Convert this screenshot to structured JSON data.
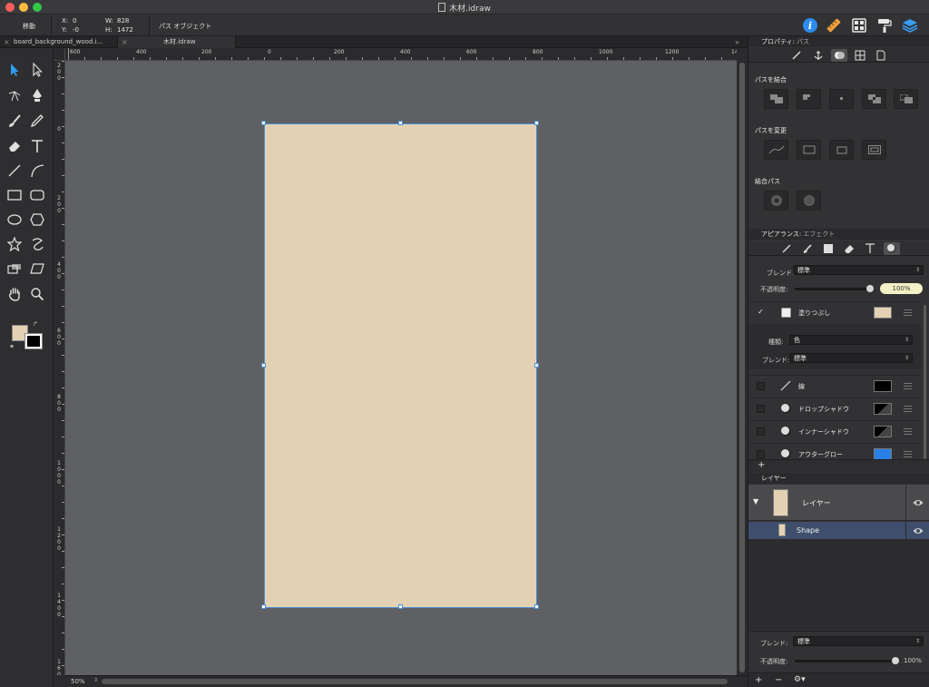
{
  "window": {
    "title": "木材.idraw"
  },
  "toolbar": {
    "mode_label": "移動",
    "x_label": "X:",
    "x_value": "0",
    "y_label": "Y:",
    "y_value": "-0",
    "w_label": "W:",
    "w_value": "828",
    "h_label": "H:",
    "h_value": "1472",
    "object_type": "パス オブジェクト",
    "icons": [
      "info-icon",
      "ruler-icon",
      "components-icon",
      "paint-roller-icon",
      "layers-icon"
    ]
  },
  "tabs": [
    {
      "label": "board_background_wood.i...",
      "active": false
    },
    {
      "label": "木材.idraw",
      "active": true
    }
  ],
  "tab_overflow": "»",
  "ruler": {
    "horizontal_labels": [
      "600",
      "400",
      "200",
      "0",
      "200",
      "400",
      "600",
      "800",
      "1000",
      "1200",
      "1400"
    ],
    "vertical_labels": [
      "200",
      "0",
      "200",
      "400",
      "600",
      "800",
      "1000",
      "1200",
      "1400",
      "1600"
    ]
  },
  "status": {
    "zoom": "50%",
    "zoom_arrows": "⇕"
  },
  "properties": {
    "header": "プロパティ:",
    "header_sub": "パス",
    "tabs": [
      "pen-icon",
      "anchor-icon",
      "boolean-icon",
      "grid-icon",
      "document-icon"
    ],
    "combine_label": "パスを結合",
    "modify_label": "パスを変更",
    "compound_label": "結合パス"
  },
  "appearance": {
    "header": "アピアランス:",
    "header_sub": "エフェクト",
    "tabs": [
      "stroke-tab-icon",
      "brush-tab-icon",
      "fill-tab-icon",
      "eraser-tab-icon",
      "text-tab-icon",
      "shadow-tab-icon"
    ],
    "blend_label": "ブレンド:",
    "blend_value": "標準",
    "opacity_label": "不透明度:",
    "opacity_value": "100%",
    "fill": {
      "enabled": true,
      "name": "塗りつぶし",
      "color": "#e3d1b4"
    },
    "kind_label": "種類:",
    "kind_value": "色",
    "fill_blend_label": "ブレンド:",
    "fill_blend_value": "標準",
    "effects": [
      {
        "name": "線",
        "enabled": false,
        "icon": "line-icon",
        "swatch": "#000000"
      },
      {
        "name": "ドロップシャドウ",
        "enabled": false,
        "icon": "shadow-icon",
        "swatch": "#000000"
      },
      {
        "name": "インナーシャドウ",
        "enabled": false,
        "icon": "inner-shadow-icon",
        "swatch": "#000000"
      },
      {
        "name": "アウターグロー",
        "enabled": false,
        "icon": "glow-icon",
        "swatch": "#2a7fe8"
      }
    ],
    "add": "+"
  },
  "layers": {
    "header": "レイヤー",
    "layer_name": "レイヤー",
    "shape_name": "Shape",
    "blend_label": "ブレンド:",
    "blend_value": "標準",
    "opacity_label": "不透明度:",
    "opacity_value": "100%",
    "footer": {
      "add": "+",
      "remove": "−",
      "gear": "⚙▾"
    }
  },
  "colors": {
    "canvas": "#5f6064",
    "shape_fill": "#e3d1b4",
    "selection": "#4a8fd6",
    "layer_selected": "#3e4e6b"
  }
}
